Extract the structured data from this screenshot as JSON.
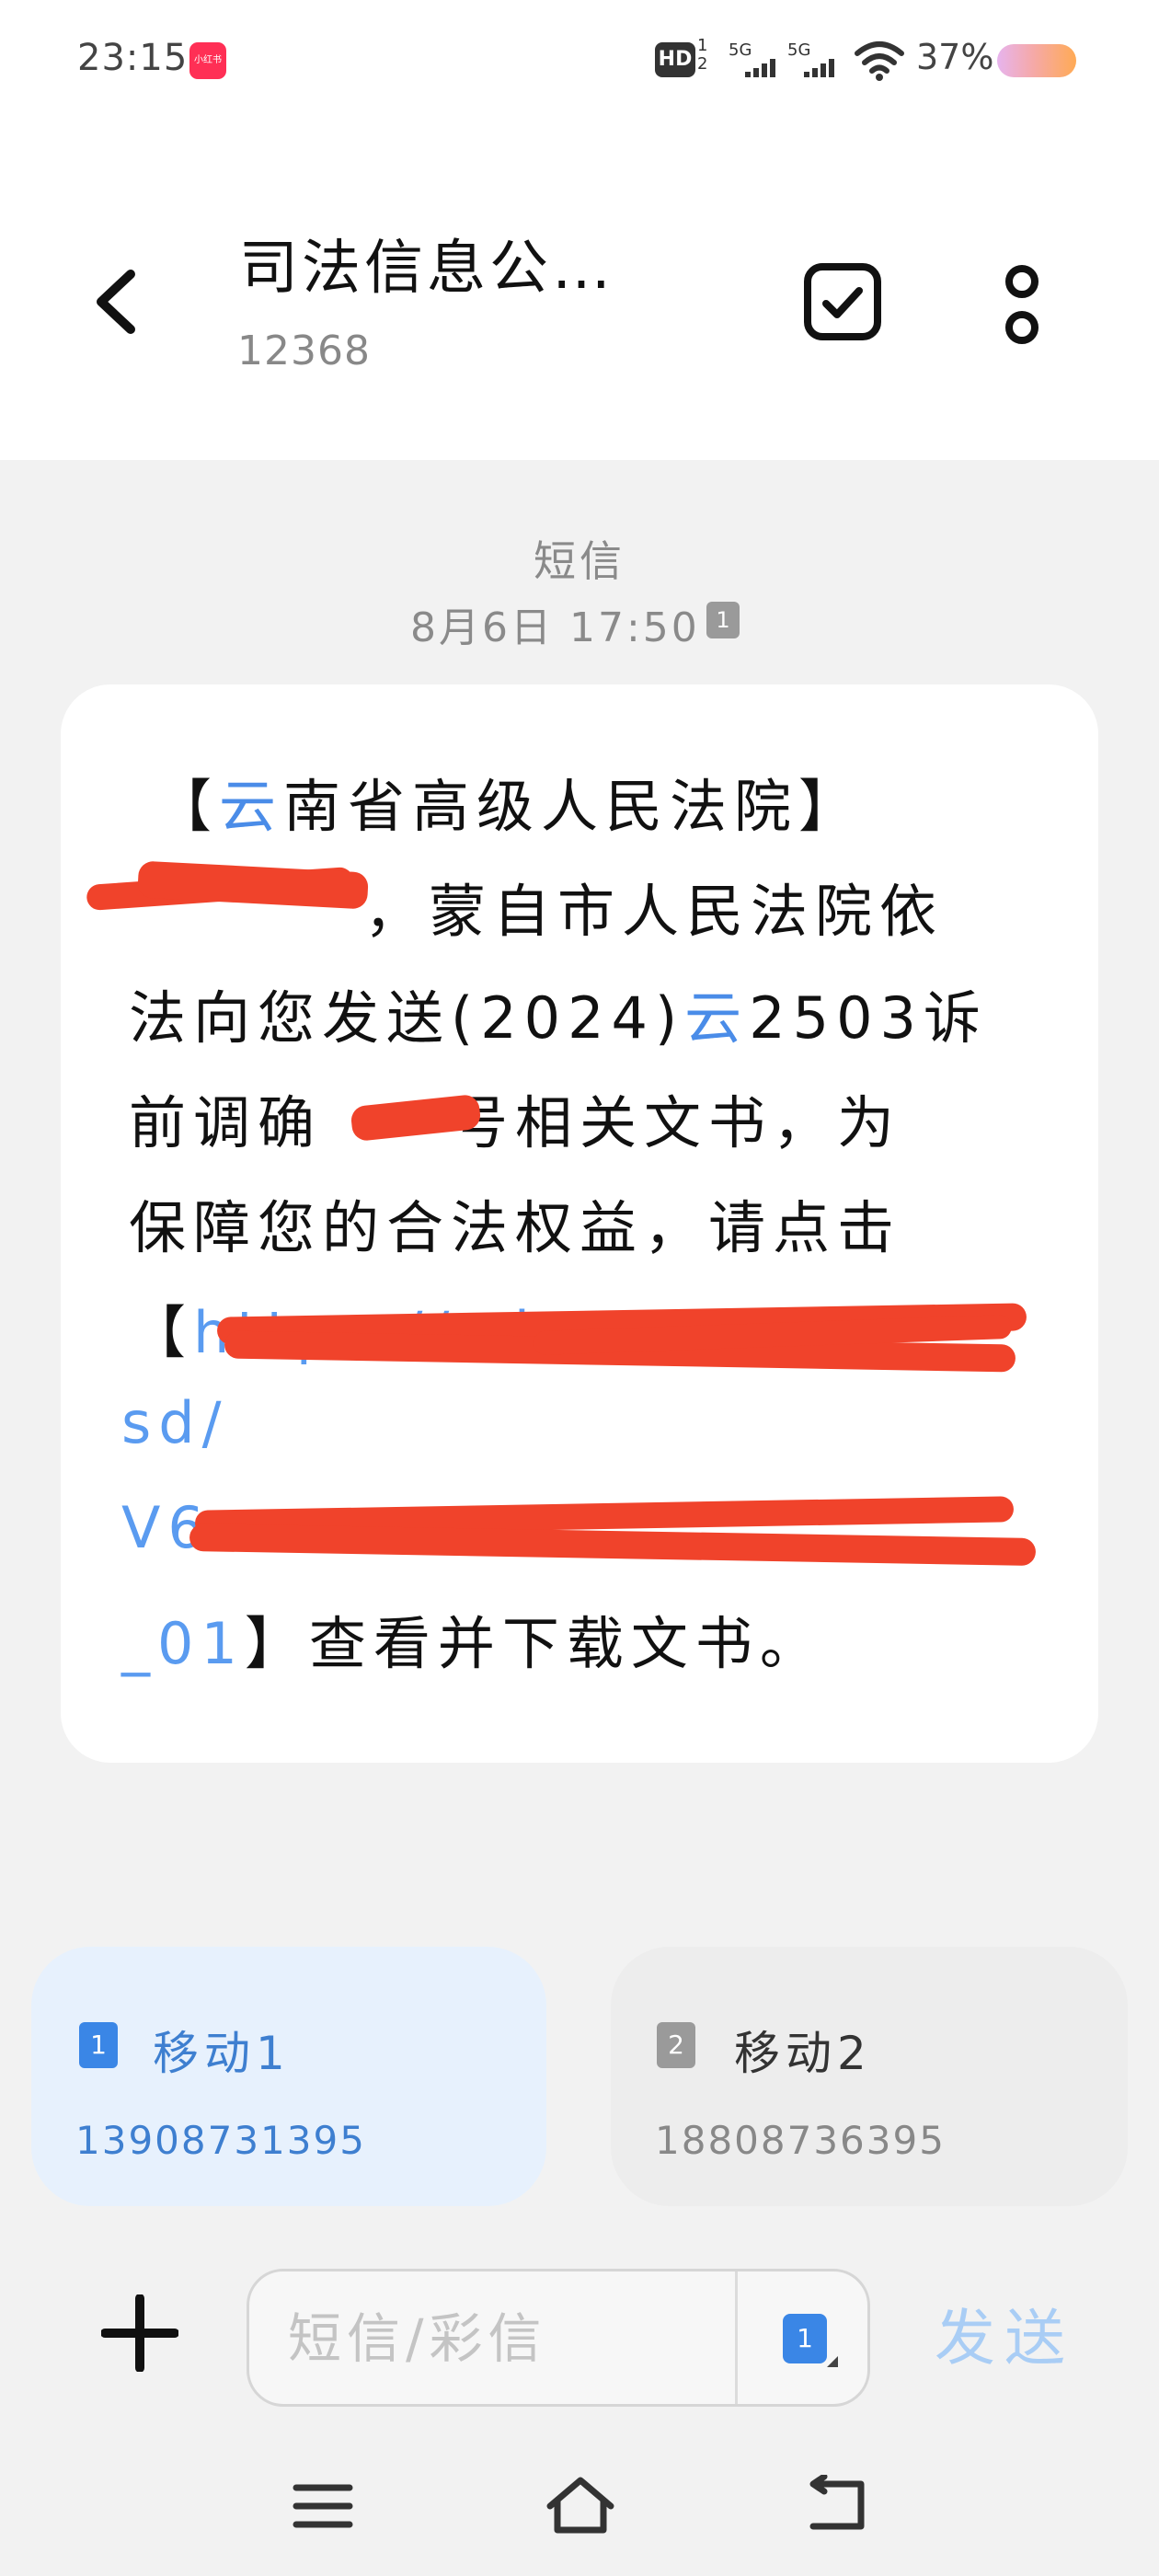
{
  "status_bar": {
    "time": "23:15",
    "app_badge": "小红书",
    "hd_label": "HD",
    "hd_sub": "1\n2",
    "signal1_label": "5G",
    "signal2_label": "5G",
    "battery": "37%",
    "battery_color": "#ffaa55"
  },
  "header": {
    "title": "司法信息公…",
    "subtitle": "12368",
    "back_icon": "chevron-left-icon",
    "select_icon": "checkbox-icon",
    "more_icon": "more-vertical-icon"
  },
  "conversation": {
    "type_label": "短信",
    "timestamp": "8月6日 17:50",
    "sim_indicator": "1",
    "message": {
      "line1_bracket_open": "【",
      "line1_highlight": "云",
      "line1_rest": "南省高级人民法院】",
      "line2": "，蒙自市人民法院依",
      "line3_a": "法向您发送(2024)",
      "line3_highlight": "云",
      "line3_b": "2503诉",
      "line4_a": "前调确",
      "line4_b": "号相关文书，为",
      "line5": "保障您的合法权益，请点击",
      "line6_bracket": "【",
      "line6_link": "https://sd...",
      "line7_link": "sd/",
      "line8_link": "V6",
      "line9_link": "_01",
      "line9_rest": "】查看并下载文书。"
    },
    "redaction_color": "#f0432b",
    "link_color": "#5a9bf0"
  },
  "sim_cards": [
    {
      "index": "1",
      "name": "移动1",
      "number": "13908731395",
      "selected": true,
      "color": "#3a86e6"
    },
    {
      "index": "2",
      "name": "移动2",
      "number": "18808736395",
      "selected": false,
      "color": "#9a9a9a"
    }
  ],
  "compose": {
    "placeholder": "短信/彩信",
    "value": "",
    "sim_switch": "1",
    "send_label": "发送",
    "send_color": "#a9cdf5",
    "attach_icon": "plus-icon"
  },
  "nav_bar": {
    "menu_icon": "menu-icon",
    "home_icon": "home-icon",
    "back_icon": "back-icon"
  }
}
